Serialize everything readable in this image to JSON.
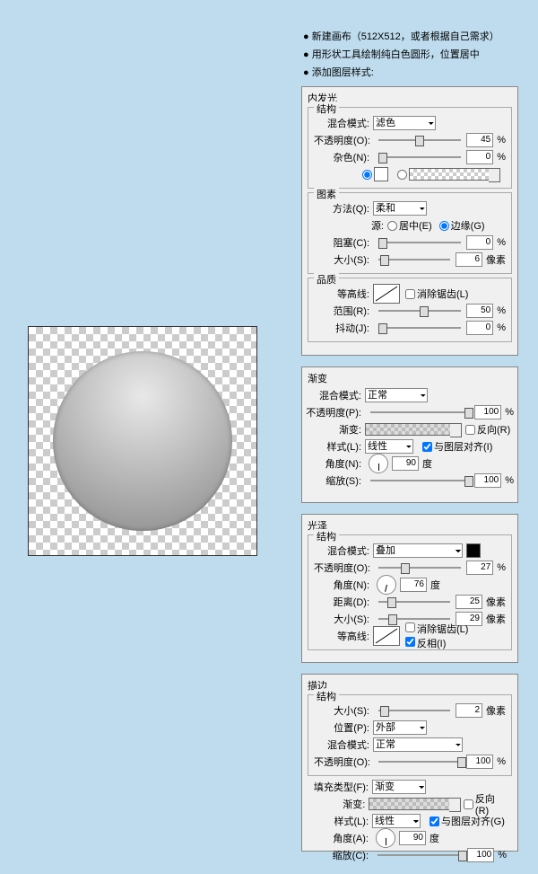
{
  "bullets": {
    "b1": "● 新建画布（512X512，或者根据自己需求）",
    "b2": "● 用形状工具绘制纯白色圆形，位置居中",
    "b3": "● 添加图层样式:"
  },
  "p1": {
    "title": "内发光",
    "struct": "结构",
    "blendLabel": "混合模式:",
    "blendValue": "滤色",
    "opacityLabel": "不透明度(O):",
    "opacityValue": "45",
    "pct": "%",
    "noiseLabel": "杂色(N):",
    "noiseValue": "0",
    "elements": "图素",
    "methodLabel": "方法(Q):",
    "methodValue": "柔和",
    "sourceLabel": "源:",
    "sourceCenter": "居中(E)",
    "sourceEdge": "边缘(G)",
    "chokeLabel": "阻塞(C):",
    "chokeValue": "0",
    "sizeLabel": "大小(S):",
    "sizeValue": "6",
    "px": "像素",
    "quality": "品质",
    "contourLabel": "等高线:",
    "aaLabel": "消除锯齿(L)",
    "rangeLabel": "范围(R):",
    "rangeValue": "50",
    "jitterLabel": "抖动(J):",
    "jitterValue": "0"
  },
  "p2": {
    "title": "渐变",
    "blendLabel": "混合模式:",
    "blendValue": "正常",
    "opacityLabel": "不透明度(P):",
    "opacityValue": "100",
    "pct": "%",
    "gradLabel": "渐变:",
    "reverseLabel": "反向(R)",
    "styleLabel": "样式(L):",
    "styleValue": "线性",
    "alignLabel": "与图层对齐(I)",
    "angleLabel": "角度(N):",
    "angleValue": "90",
    "deg": "度",
    "scaleLabel": "缩放(S):",
    "scaleValue": "100"
  },
  "p3": {
    "title": "光泽",
    "struct": "结构",
    "blendLabel": "混合模式:",
    "blendValue": "叠加",
    "opacityLabel": "不透明度(O):",
    "opacityValue": "27",
    "pct": "%",
    "angleLabel": "角度(N):",
    "angleValue": "76",
    "deg": "度",
    "distLabel": "距离(D):",
    "distValue": "25",
    "sizeLabel": "大小(S):",
    "sizeValue": "29",
    "px": "像素",
    "contourLabel": "等高线:",
    "aaLabel": "消除锯齿(L)",
    "invertLabel": "反相(I)"
  },
  "p4": {
    "title": "描边",
    "struct": "结构",
    "sizeLabel": "大小(S):",
    "sizeValue": "2",
    "px": "像素",
    "posLabel": "位置(P):",
    "posValue": "外部",
    "blendLabel": "混合模式:",
    "blendValue": "正常",
    "opacityLabel": "不透明度(O):",
    "opacityValue": "100",
    "pct": "%",
    "fillTypeLabel": "填充类型(F):",
    "fillTypeValue": "渐变",
    "gradLabel": "渐变:",
    "reverseLabel": "反向(R)",
    "styleLabel": "样式(L):",
    "styleValue": "线性",
    "alignLabel": "与图层对齐(G)",
    "angleLabel": "角度(A):",
    "angleValue": "90",
    "deg": "度",
    "scaleLabel": "缩放(C):",
    "scaleValue": "100"
  }
}
